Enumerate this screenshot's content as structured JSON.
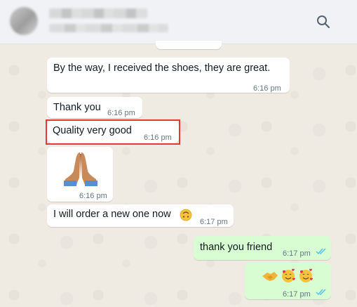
{
  "header": {
    "contact_name": "",
    "contact_status": "",
    "search_icon": "search-icon"
  },
  "messages": [
    {
      "id": "m1",
      "direction": "in",
      "text": "By the way, I received the shoes, they are great.",
      "time": "6:16 pm"
    },
    {
      "id": "m2",
      "direction": "in",
      "text": "Thank you",
      "time": "6:16 pm"
    },
    {
      "id": "m3",
      "direction": "in",
      "text": "Quality very good",
      "time": "6:16 pm",
      "highlighted": true
    },
    {
      "id": "m4",
      "direction": "in",
      "text": "",
      "emoji": "folded-hands-medium-skin-tone",
      "time": "6:16 pm"
    },
    {
      "id": "m5",
      "direction": "in",
      "text": "I will order a new one now",
      "emoji": "upside-down-face",
      "time": "6:17 pm"
    },
    {
      "id": "m6",
      "direction": "out",
      "text": "thank you friend",
      "time": "6:17 pm",
      "status": "read"
    },
    {
      "id": "m7",
      "direction": "out",
      "text": "",
      "emoji": [
        "handshake",
        "smiling-face-with-hearts",
        "smiling-face-with-hearts"
      ],
      "time": "6:17 pm",
      "status": "read"
    }
  ],
  "colors": {
    "incoming_bubble": "#ffffff",
    "outgoing_bubble": "#d9fdd3",
    "read_ticks": "#53bdeb",
    "highlight_box": "#e53935",
    "chat_background": "#efeae2"
  }
}
